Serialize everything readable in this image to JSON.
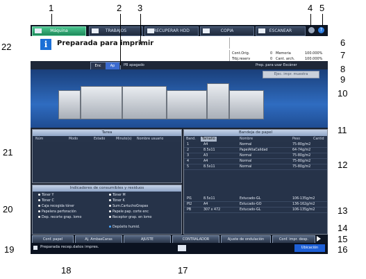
{
  "tabs": [
    {
      "label": "Máquina",
      "active": true
    },
    {
      "label": "TRABAJOS",
      "active": false
    },
    {
      "label": "RECUPERAR HDD",
      "active": false
    },
    {
      "label": "COPIA",
      "active": false
    },
    {
      "label": "ESCANEAR",
      "active": false
    }
  ],
  "status": {
    "title": "Preparada para imprimir"
  },
  "counters": {
    "cont_orig_label": "Cont.Orig.",
    "cont_orig_value": "0",
    "trbj_reserv_label": "Trbj.reserv",
    "trbj_reserv_value": "0",
    "memoria_label": "Memoria",
    "memoria_value": "100.000%",
    "cant_arch_label": "Cant. arch.",
    "cant_arch_value": "100.000%"
  },
  "mode_toggle": {
    "on": "Enc",
    "off": "Ap"
  },
  "pb_status": "PB apagado",
  "scanner_status": "Prep. para usar Escáner",
  "dest_button": "Ejec. impr. muestra",
  "tareas": {
    "title": "Tarea",
    "columns": [
      "Núm",
      "Modo",
      "Estado",
      "Minuto(s)",
      "Nombre usuario"
    ]
  },
  "consumibles": {
    "title": "Indicadores de consumibles y residuos",
    "items": [
      {
        "label": "Tóner Y"
      },
      {
        "label": "Tóner M"
      },
      {
        "label": "Tóner C"
      },
      {
        "label": "Tóner K"
      },
      {
        "label": "Caja recogida tóner"
      },
      {
        "label": "Sum.CartuchoGrapas"
      },
      {
        "label": "Papelera perforación"
      },
      {
        "label": "Papele pap. corte enc"
      },
      {
        "label": "Dep. recorte grap. lomo"
      },
      {
        "label": "Receptor grap. en lomo"
      }
    ],
    "deposito": "Depósito humid."
  },
  "bandeja": {
    "title": "Bandeja de papel",
    "columns": [
      "Band.",
      "Tamaño",
      "Nombre",
      "Peso",
      "Cantid"
    ],
    "trays": [
      {
        "tray": "1",
        "size": "A4",
        "name": "Normal",
        "weight": "75-80g/m2"
      },
      {
        "tray": "2",
        "size": "8.5x11",
        "name": "PapelAltaCalidad",
        "weight": "64-74g/m2"
      },
      {
        "tray": "3",
        "size": "A3",
        "name": "Normal",
        "weight": "75-80g/m2"
      },
      {
        "tray": "4",
        "size": "A4",
        "name": "Normal",
        "weight": "75-80g/m2"
      },
      {
        "tray": "5",
        "size": "8.5x11",
        "name": "Normal",
        "weight": "75-80g/m2"
      }
    ],
    "extra_trays": [
      {
        "tray": "PI1",
        "size": "8.5x11",
        "name": "Estucado-GL",
        "weight": "106-135g/m2"
      },
      {
        "tray": "PI2",
        "size": "A4",
        "name": "Estucado-GO",
        "weight": "136-162g/m2"
      },
      {
        "tray": "PB",
        "size": "307 x 472",
        "name": "Estucado-GL",
        "weight": "106-135g/m2"
      }
    ]
  },
  "bottom_buttons": [
    "Conf. papel",
    "Aj. AmbasCaras",
    "AJUSTE",
    "CONTRALADOR",
    "Ajuste de ondulación",
    "Conf. impr. desp."
  ],
  "footer": {
    "message": "Preparada recep.datos impres.",
    "right": "Ubicación"
  },
  "callouts": [
    "1",
    "2",
    "3",
    "4",
    "5",
    "6",
    "7",
    "8",
    "9",
    "10",
    "11",
    "12",
    "13",
    "14",
    "15",
    "16",
    "17",
    "18",
    "19",
    "20",
    "21",
    "22"
  ]
}
